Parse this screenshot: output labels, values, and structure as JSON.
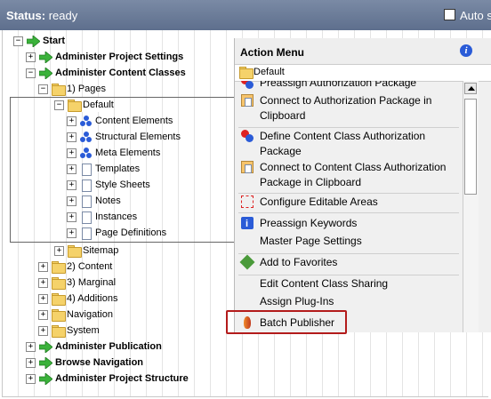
{
  "status": {
    "label": "Status:",
    "value": "ready",
    "auto_label": "Auto s"
  },
  "tree": [
    {
      "id": "start",
      "label": "Start",
      "exp": "⊟",
      "icon": "arrow",
      "bold": true
    },
    {
      "id": "admin-project-settings",
      "label": "Administer Project Settings",
      "exp": "+",
      "icon": "arrow",
      "bold": true
    },
    {
      "id": "admin-content-classes",
      "label": "Administer Content Classes",
      "exp": "−",
      "icon": "arrow",
      "bold": true
    },
    {
      "id": "pages",
      "label": "1) Pages",
      "exp": "−",
      "icon": "folder"
    },
    {
      "id": "default",
      "label": "Default",
      "exp": "−",
      "icon": "folder"
    },
    {
      "id": "content-elements",
      "label": "Content Elements",
      "exp": "+",
      "icon": "blue"
    },
    {
      "id": "structural-elements",
      "label": "Structural Elements",
      "exp": "+",
      "icon": "blue"
    },
    {
      "id": "meta-elements",
      "label": "Meta Elements",
      "exp": "+",
      "icon": "blue"
    },
    {
      "id": "templates",
      "label": "Templates",
      "exp": "+",
      "icon": "page"
    },
    {
      "id": "style-sheets",
      "label": "Style Sheets",
      "exp": "+",
      "icon": "page"
    },
    {
      "id": "notes",
      "label": "Notes",
      "exp": "+",
      "icon": "page"
    },
    {
      "id": "instances",
      "label": "Instances",
      "exp": "+",
      "icon": "page"
    },
    {
      "id": "page-definitions",
      "label": "Page Definitions",
      "exp": "+",
      "icon": "page"
    },
    {
      "id": "sitemap",
      "label": "Sitemap",
      "exp": "+",
      "icon": "folder"
    },
    {
      "id": "content",
      "label": "2) Content",
      "exp": "+",
      "icon": "folder"
    },
    {
      "id": "marginal",
      "label": "3) Marginal",
      "exp": "+",
      "icon": "folder"
    },
    {
      "id": "additions",
      "label": "4) Additions",
      "exp": "+",
      "icon": "folder"
    },
    {
      "id": "navigation",
      "label": "Navigation",
      "exp": "+",
      "icon": "folder"
    },
    {
      "id": "system",
      "label": "System",
      "exp": "+",
      "icon": "folder"
    },
    {
      "id": "admin-publication",
      "label": "Administer Publication",
      "exp": "+",
      "icon": "arrow",
      "bold": true
    },
    {
      "id": "browse-navigation",
      "label": "Browse Navigation",
      "exp": "+",
      "icon": "arrow",
      "bold": true
    },
    {
      "id": "admin-project-structure",
      "label": "Administer Project Structure",
      "exp": "+",
      "icon": "arrow",
      "bold": true
    }
  ],
  "menu": {
    "title": "Action Menu",
    "sub": "Default",
    "items": [
      {
        "id": "preassign-auth-pkg",
        "label": "Preassign Authorization Package",
        "icon": "define"
      },
      {
        "id": "connect-auth-pkg",
        "label": "Connect to Authorization Package in Clipboard",
        "icon": "pkg"
      },
      {
        "id": "define-cc-auth",
        "label": "Define Content Class Authorization Package",
        "icon": "define"
      },
      {
        "id": "connect-cc-auth",
        "label": "Connect to Content Class Authorization Package in Clipboard",
        "icon": "pkg"
      },
      {
        "id": "configure-editable",
        "label": "Configure Editable Areas",
        "icon": "area"
      },
      {
        "id": "preassign-keywords",
        "label": "Preassign Keywords",
        "icon": "kw"
      },
      {
        "id": "master-page-settings",
        "label": "Master Page Settings",
        "icon": "none"
      },
      {
        "id": "add-favorites",
        "label": "Add to Favorites",
        "icon": "fav"
      },
      {
        "id": "edit-sharing",
        "label": "Edit Content Class Sharing",
        "icon": "none"
      },
      {
        "id": "assign-plugins",
        "label": "Assign Plug-Ins",
        "icon": "none"
      },
      {
        "id": "batch-publisher",
        "label": "Batch Publisher",
        "icon": "bp"
      }
    ]
  },
  "colors": {
    "status_bg": "#6b7b97",
    "highlight": "#b31b1b",
    "arrow": "#3bb23b"
  }
}
